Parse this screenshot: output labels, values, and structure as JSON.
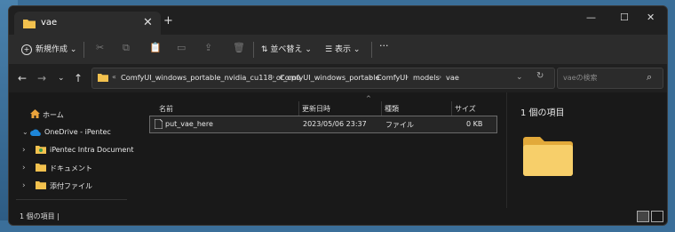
{
  "window": {
    "tab_title": "vae",
    "tab_close": "✕",
    "new_tab": "+",
    "minimize": "—",
    "maximize": "☐",
    "close": "✕"
  },
  "toolbar": {
    "new_label": "新規作成",
    "sort_label": "並べ替え",
    "view_label": "表示",
    "more_label": "···",
    "icons": [
      "cut-icon",
      "copy-icon",
      "paste-icon",
      "rename-icon",
      "share-icon",
      "delete-icon"
    ]
  },
  "address": {
    "crumbs": [
      "ComfyUI_windows_portable_nvidia_cu118_or_cpu",
      "ComfyUI_windows_portable",
      "ComfyUI",
      "models",
      "vae"
    ],
    "overflow": "«",
    "search_placeholder": "vaeの検索"
  },
  "nav": {
    "items": [
      {
        "label": "ホーム",
        "icon": "home-icon"
      },
      {
        "label": "OneDrive - iPentec",
        "icon": "onedrive-icon"
      },
      {
        "label": "iPentec Intra Document",
        "icon": "shared-folder-icon"
      },
      {
        "label": "ドキュメント",
        "icon": "folder-icon"
      },
      {
        "label": "添付ファイル",
        "icon": "folder-icon"
      }
    ]
  },
  "columns": {
    "name": "名前",
    "modified": "更新日時",
    "type": "種類",
    "size": "サイズ"
  },
  "files": [
    {
      "name": "put_vae_here",
      "modified": "2023/05/06 23:37",
      "type": "ファイル",
      "size": "0 KB"
    }
  ],
  "preview": {
    "title": "1 個の項目"
  },
  "status": {
    "text": "1 個の項目  |"
  },
  "colors": {
    "accent": "#3b6f9a",
    "folder": "#f2c14e"
  }
}
